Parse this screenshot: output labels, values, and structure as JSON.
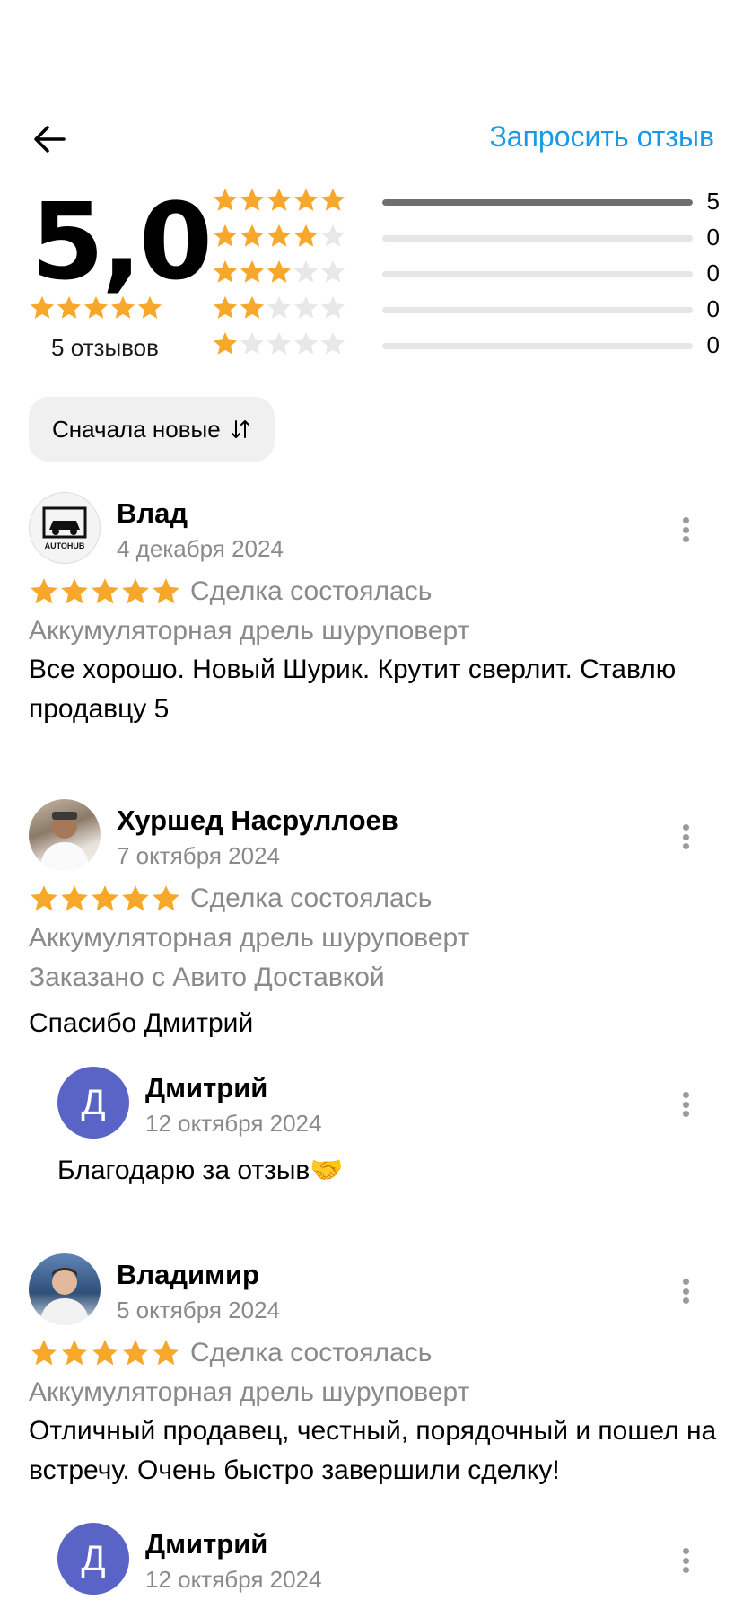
{
  "header": {
    "request_label": "Запросить отзыв"
  },
  "summary": {
    "rating": "5,0",
    "stars": 5,
    "reviews_count": "5 отзывов",
    "distribution": [
      {
        "stars": 5,
        "count": "5",
        "fraction": 1.0
      },
      {
        "stars": 4,
        "count": "0",
        "fraction": 0
      },
      {
        "stars": 3,
        "count": "0",
        "fraction": 0
      },
      {
        "stars": 2,
        "count": "0",
        "fraction": 0
      },
      {
        "stars": 1,
        "count": "0",
        "fraction": 0
      }
    ]
  },
  "sort": {
    "label": "Сначала новые"
  },
  "colors": {
    "star_filled": "#f7a82b",
    "star_empty": "#e8e8e8",
    "accent": "#1a9ae6",
    "reply_avatar": "#5a63c6"
  },
  "reviews": [
    {
      "author": "Влад",
      "date": "4 декабря 2024",
      "rating": 5,
      "status": "Сделка состоялась",
      "item": "Аккумуляторная дрель шуруповерт",
      "text": "Все хорошо. Новый Шурик. Крутит сверлит. Ставлю продавцу 5",
      "avatar_text": "AUTOHUB"
    },
    {
      "author": "Хуршед Насруллоев",
      "date": "7 октября 2024",
      "rating": 5,
      "status": "Сделка состоялась",
      "item": "Аккумуляторная дрель шуруповерт",
      "delivery": "Заказано с Авито Доставкой",
      "text": "Спасибо Дмитрий",
      "reply": {
        "initial": "Д",
        "author": "Дмитрий",
        "date": "12 октября 2024",
        "text": "Благодарю за отзыв🤝"
      }
    },
    {
      "author": "Владимир",
      "date": "5 октября 2024",
      "rating": 5,
      "status": "Сделка состоялась",
      "item": "Аккумуляторная дрель шуруповерт",
      "text": "Отличный продавец, честный, порядочный и пошел на встречу. Очень быстро завершили сделку!",
      "reply": {
        "initial": "Д",
        "author": "Дмитрий",
        "date": "12 октября 2024"
      }
    }
  ]
}
